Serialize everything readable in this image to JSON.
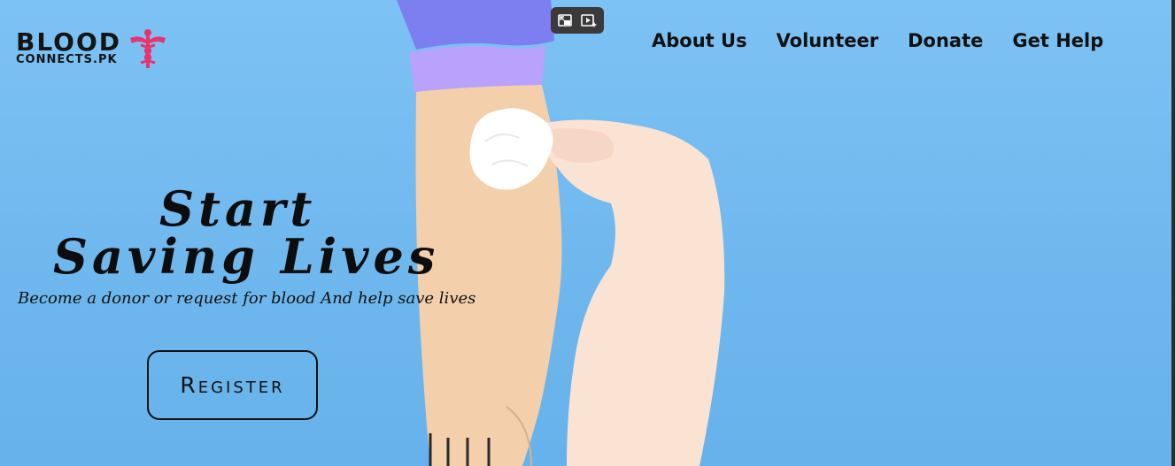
{
  "brand": {
    "name_main": "BLOOD",
    "name_sub": "CONNECTS.PK",
    "emblem_icon": "caduceus-icon",
    "emblem_color": "#e8336d"
  },
  "video_controls": {
    "buttons": [
      {
        "icon": "picture-in-picture-exit-icon"
      },
      {
        "icon": "video-play-sparkle-icon"
      }
    ]
  },
  "nav": {
    "items": [
      {
        "label": "About Us"
      },
      {
        "label": "Volunteer"
      },
      {
        "label": "Donate"
      },
      {
        "label": "Get Help"
      }
    ]
  },
  "hero": {
    "headline_line1": "Start",
    "headline_line2": "Saving Lives",
    "subtitle": "Become a donor or request for blood  And help save lives",
    "register_label": "Register",
    "background_color": "#74bdf2"
  }
}
